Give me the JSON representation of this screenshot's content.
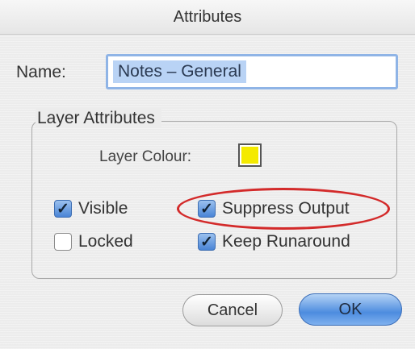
{
  "window": {
    "title": "Attributes"
  },
  "name_field": {
    "label": "Name:",
    "value": "Notes – General"
  },
  "layer_attributes": {
    "title": "Layer Attributes",
    "colour_label": "Layer Colour:",
    "colour_value": "#f4ea00",
    "checkboxes": [
      {
        "label": "Visible",
        "checked": true
      },
      {
        "label": "Locked",
        "checked": false
      },
      {
        "label": "Suppress Output",
        "checked": true
      },
      {
        "label": "Keep Runaround",
        "checked": true
      }
    ]
  },
  "buttons": {
    "cancel": "Cancel",
    "ok": "OK"
  }
}
